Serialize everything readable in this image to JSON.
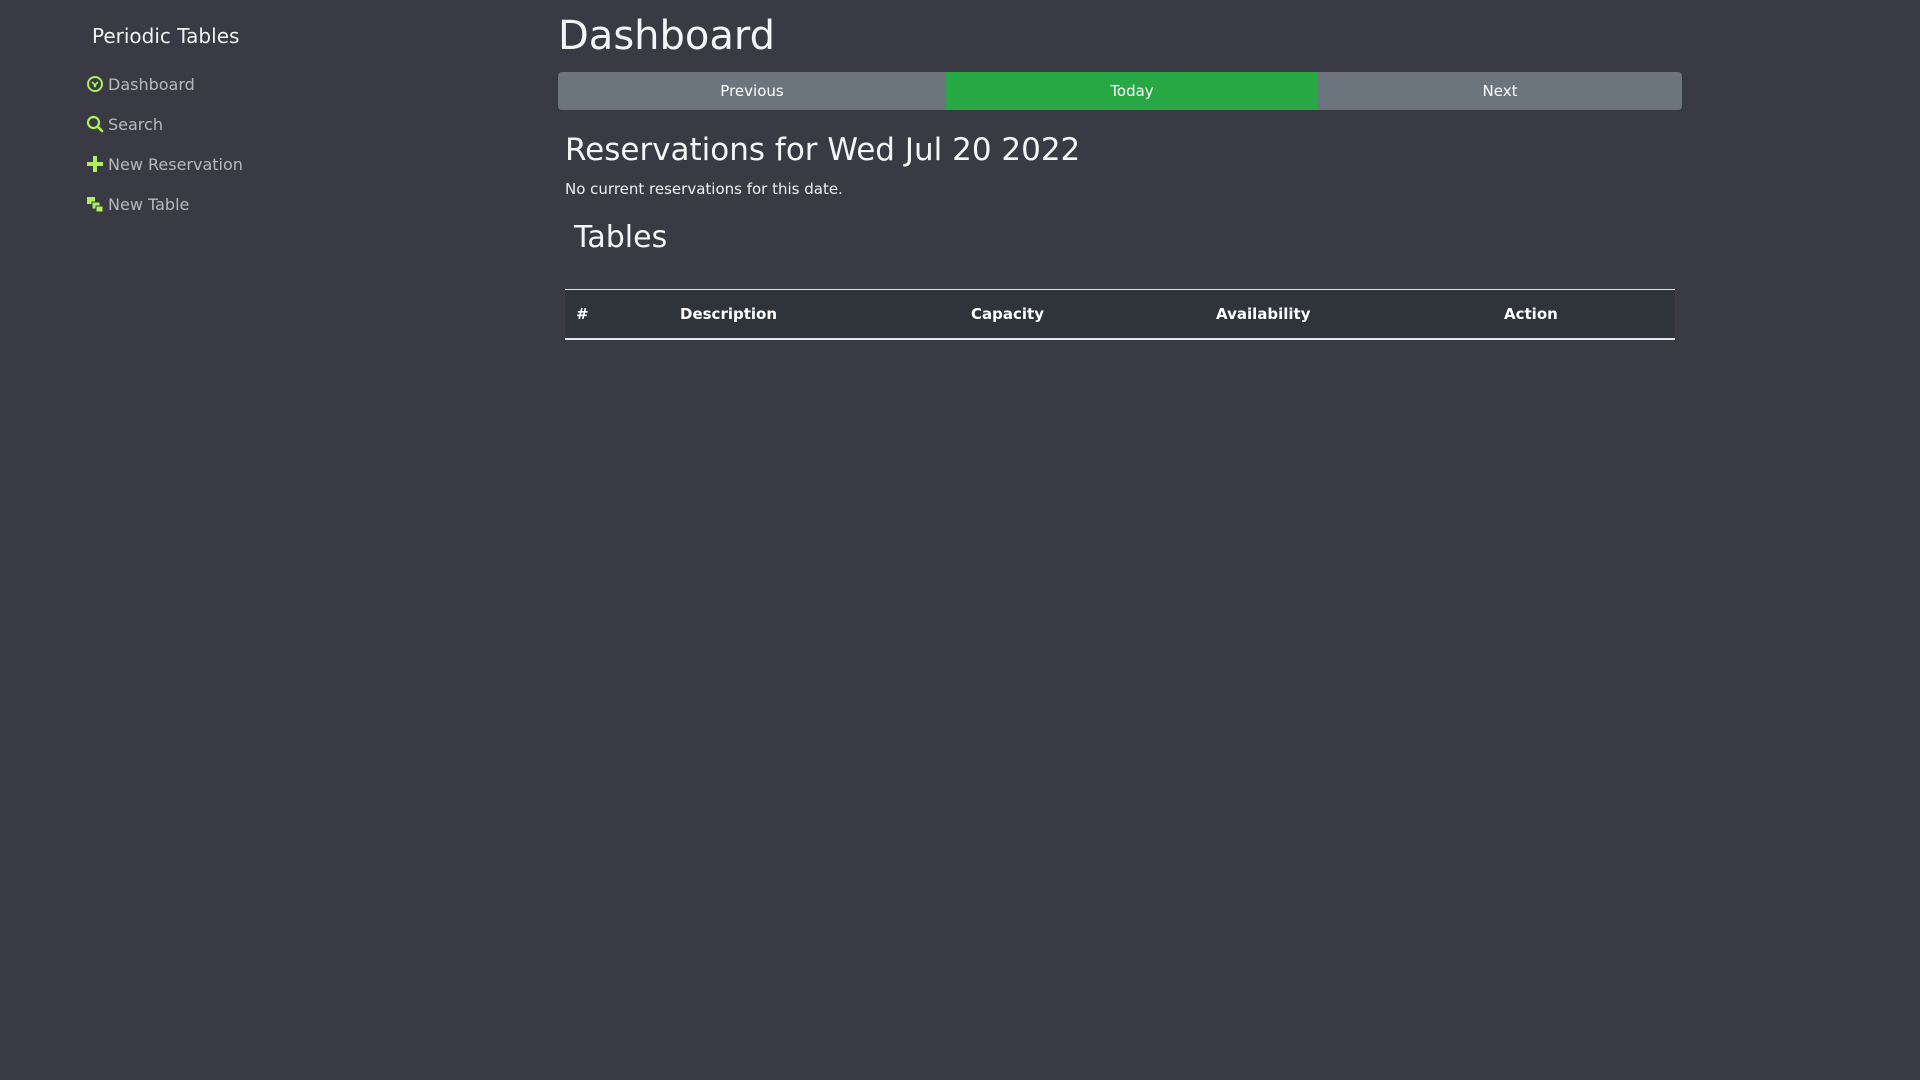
{
  "sidebar": {
    "brand": "Periodic Tables",
    "items": [
      {
        "label": "Dashboard",
        "icon": "dashboard-icon"
      },
      {
        "label": "Search",
        "icon": "search-icon"
      },
      {
        "label": "New Reservation",
        "icon": "plus-icon"
      },
      {
        "label": "New Table",
        "icon": "layers-icon"
      }
    ],
    "icon_color": "#b0ef5a"
  },
  "main": {
    "title": "Dashboard",
    "nav_buttons": {
      "previous": "Previous",
      "today": "Today",
      "next": "Next"
    },
    "reservations_heading": "Reservations for Wed Jul 20 2022",
    "reservations_empty": "No current reservations for this date.",
    "tables_heading": "Tables",
    "table_columns": [
      "#",
      "Description",
      "Capacity",
      "Availability",
      "Action"
    ]
  },
  "colors": {
    "background": "#3a3a45",
    "today_button": "#28a745",
    "secondary_button": "#6c757d"
  }
}
